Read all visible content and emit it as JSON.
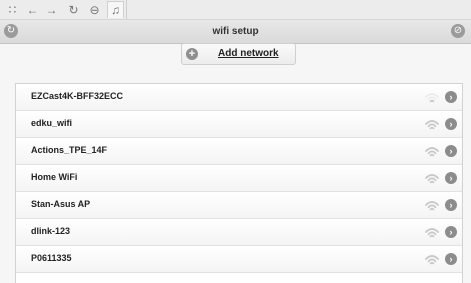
{
  "header": {
    "title": "wifi setup"
  },
  "actions": {
    "add_network_label": "Add network"
  },
  "icons": {
    "grid": "∷",
    "back": "←",
    "forward": "→",
    "refresh": "↻",
    "stop": "⊖",
    "media": "♫",
    "header_left": "↻",
    "header_right": "⊘",
    "add": "+",
    "chevron": "›"
  },
  "networks": [
    {
      "name": "EZCast4K-BFF32ECC",
      "signal": 1
    },
    {
      "name": "edku_wifi",
      "signal": 3
    },
    {
      "name": "Actions_TPE_14F",
      "signal": 3
    },
    {
      "name": "Home WiFi",
      "signal": 3
    },
    {
      "name": "Stan-Asus AP",
      "signal": 3
    },
    {
      "name": "dlink-123",
      "signal": 3
    },
    {
      "name": "P0611335",
      "signal": 3
    }
  ]
}
